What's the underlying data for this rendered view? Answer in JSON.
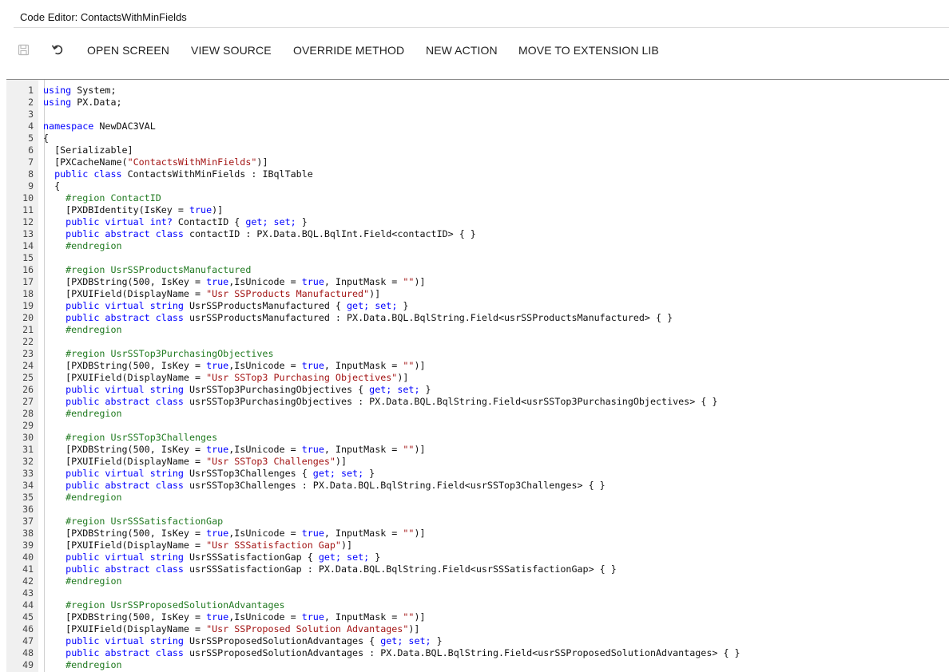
{
  "window": {
    "title": "Code Editor: ContactsWithMinFields"
  },
  "toolbar": {
    "save_icon": "save-icon",
    "undo_icon": "undo-icon",
    "buttons": [
      {
        "label": "OPEN SCREEN"
      },
      {
        "label": "VIEW SOURCE"
      },
      {
        "label": "OVERRIDE METHOD"
      },
      {
        "label": "NEW ACTION"
      },
      {
        "label": "MOVE TO EXTENSION LIB"
      }
    ]
  },
  "colors": {
    "keyword": "#0000ff",
    "string": "#a31515",
    "region": "#217a21",
    "gutter_bg": "#f0f0f0"
  },
  "code": {
    "lines": [
      [
        {
          "t": "using",
          "k": "kw"
        },
        {
          "t": " System;"
        }
      ],
      [
        {
          "t": "using",
          "k": "kw"
        },
        {
          "t": " PX.Data;"
        }
      ],
      [],
      [
        {
          "t": "namespace",
          "k": "kw"
        },
        {
          "t": " NewDAC3VAL"
        }
      ],
      [
        {
          "t": "{"
        }
      ],
      [
        {
          "t": "  [Serializable]"
        }
      ],
      [
        {
          "t": "  [PXCacheName("
        },
        {
          "t": "\"ContactsWithMinFields\"",
          "k": "str"
        },
        {
          "t": ")]"
        }
      ],
      [
        {
          "t": "  "
        },
        {
          "t": "public class",
          "k": "kw"
        },
        {
          "t": " ContactsWithMinFields : IBqlTable"
        }
      ],
      [
        {
          "t": "  {"
        }
      ],
      [
        {
          "t": "    #region ContactID",
          "k": "reg"
        }
      ],
      [
        {
          "t": "    [PXDBIdentity(IsKey = "
        },
        {
          "t": "true",
          "k": "kw"
        },
        {
          "t": ")]"
        }
      ],
      [
        {
          "t": "    "
        },
        {
          "t": "public virtual int?",
          "k": "kw"
        },
        {
          "t": " ContactID { "
        },
        {
          "t": "get;",
          "k": "kw"
        },
        {
          "t": " "
        },
        {
          "t": "set;",
          "k": "kw"
        },
        {
          "t": " }"
        }
      ],
      [
        {
          "t": "    "
        },
        {
          "t": "public abstract class",
          "k": "kw"
        },
        {
          "t": " contactID : PX.Data.BQL.BqlInt.Field<contactID> { }"
        }
      ],
      [
        {
          "t": "    #endregion",
          "k": "reg"
        }
      ],
      [],
      [
        {
          "t": "    #region UsrSSProductsManufactured",
          "k": "reg"
        }
      ],
      [
        {
          "t": "    [PXDBString(500, IsKey = "
        },
        {
          "t": "true",
          "k": "kw"
        },
        {
          "t": ",IsUnicode = "
        },
        {
          "t": "true",
          "k": "kw"
        },
        {
          "t": ", InputMask = "
        },
        {
          "t": "\"\"",
          "k": "str"
        },
        {
          "t": ")]"
        }
      ],
      [
        {
          "t": "    [PXUIField(DisplayName = "
        },
        {
          "t": "\"Usr SSProducts Manufactured\"",
          "k": "str"
        },
        {
          "t": ")]"
        }
      ],
      [
        {
          "t": "    "
        },
        {
          "t": "public virtual string",
          "k": "kw"
        },
        {
          "t": " UsrSSProductsManufactured { "
        },
        {
          "t": "get;",
          "k": "kw"
        },
        {
          "t": " "
        },
        {
          "t": "set;",
          "k": "kw"
        },
        {
          "t": " }"
        }
      ],
      [
        {
          "t": "    "
        },
        {
          "t": "public abstract class",
          "k": "kw"
        },
        {
          "t": " usrSSProductsManufactured : PX.Data.BQL.BqlString.Field<usrSSProductsManufactured> { }"
        }
      ],
      [
        {
          "t": "    #endregion",
          "k": "reg"
        }
      ],
      [],
      [
        {
          "t": "    #region UsrSSTop3PurchasingObjectives",
          "k": "reg"
        }
      ],
      [
        {
          "t": "    [PXDBString(500, IsKey = "
        },
        {
          "t": "true",
          "k": "kw"
        },
        {
          "t": ",IsUnicode = "
        },
        {
          "t": "true",
          "k": "kw"
        },
        {
          "t": ", InputMask = "
        },
        {
          "t": "\"\"",
          "k": "str"
        },
        {
          "t": ")]"
        }
      ],
      [
        {
          "t": "    [PXUIField(DisplayName = "
        },
        {
          "t": "\"Usr SSTop3 Purchasing Objectives\"",
          "k": "str"
        },
        {
          "t": ")]"
        }
      ],
      [
        {
          "t": "    "
        },
        {
          "t": "public virtual string",
          "k": "kw"
        },
        {
          "t": " UsrSSTop3PurchasingObjectives { "
        },
        {
          "t": "get;",
          "k": "kw"
        },
        {
          "t": " "
        },
        {
          "t": "set;",
          "k": "kw"
        },
        {
          "t": " }"
        }
      ],
      [
        {
          "t": "    "
        },
        {
          "t": "public abstract class",
          "k": "kw"
        },
        {
          "t": " usrSSTop3PurchasingObjectives : PX.Data.BQL.BqlString.Field<usrSSTop3PurchasingObjectives> { }"
        }
      ],
      [
        {
          "t": "    #endregion",
          "k": "reg"
        }
      ],
      [],
      [
        {
          "t": "    #region UsrSSTop3Challenges",
          "k": "reg"
        }
      ],
      [
        {
          "t": "    [PXDBString(500, IsKey = "
        },
        {
          "t": "true",
          "k": "kw"
        },
        {
          "t": ",IsUnicode = "
        },
        {
          "t": "true",
          "k": "kw"
        },
        {
          "t": ", InputMask = "
        },
        {
          "t": "\"\"",
          "k": "str"
        },
        {
          "t": ")]"
        }
      ],
      [
        {
          "t": "    [PXUIField(DisplayName = "
        },
        {
          "t": "\"Usr SSTop3 Challenges\"",
          "k": "str"
        },
        {
          "t": ")]"
        }
      ],
      [
        {
          "t": "    "
        },
        {
          "t": "public virtual string",
          "k": "kw"
        },
        {
          "t": " UsrSSTop3Challenges { "
        },
        {
          "t": "get;",
          "k": "kw"
        },
        {
          "t": " "
        },
        {
          "t": "set;",
          "k": "kw"
        },
        {
          "t": " }"
        }
      ],
      [
        {
          "t": "    "
        },
        {
          "t": "public abstract class",
          "k": "kw"
        },
        {
          "t": " usrSSTop3Challenges : PX.Data.BQL.BqlString.Field<usrSSTop3Challenges> { }"
        }
      ],
      [
        {
          "t": "    #endregion",
          "k": "reg"
        }
      ],
      [],
      [
        {
          "t": "    #region UsrSSSatisfactionGap",
          "k": "reg"
        }
      ],
      [
        {
          "t": "    [PXDBString(500, IsKey = "
        },
        {
          "t": "true",
          "k": "kw"
        },
        {
          "t": ",IsUnicode = "
        },
        {
          "t": "true",
          "k": "kw"
        },
        {
          "t": ", InputMask = "
        },
        {
          "t": "\"\"",
          "k": "str"
        },
        {
          "t": ")]"
        }
      ],
      [
        {
          "t": "    [PXUIField(DisplayName = "
        },
        {
          "t": "\"Usr SSSatisfaction Gap\"",
          "k": "str"
        },
        {
          "t": ")]"
        }
      ],
      [
        {
          "t": "    "
        },
        {
          "t": "public virtual string",
          "k": "kw"
        },
        {
          "t": " UsrSSSatisfactionGap { "
        },
        {
          "t": "get;",
          "k": "kw"
        },
        {
          "t": " "
        },
        {
          "t": "set;",
          "k": "kw"
        },
        {
          "t": " }"
        }
      ],
      [
        {
          "t": "    "
        },
        {
          "t": "public abstract class",
          "k": "kw"
        },
        {
          "t": " usrSSSatisfactionGap : PX.Data.BQL.BqlString.Field<usrSSSatisfactionGap> { }"
        }
      ],
      [
        {
          "t": "    #endregion",
          "k": "reg"
        }
      ],
      [],
      [
        {
          "t": "    #region UsrSSProposedSolutionAdvantages",
          "k": "reg"
        }
      ],
      [
        {
          "t": "    [PXDBString(500, IsKey = "
        },
        {
          "t": "true",
          "k": "kw"
        },
        {
          "t": ",IsUnicode = "
        },
        {
          "t": "true",
          "k": "kw"
        },
        {
          "t": ", InputMask = "
        },
        {
          "t": "\"\"",
          "k": "str"
        },
        {
          "t": ")]"
        }
      ],
      [
        {
          "t": "    [PXUIField(DisplayName = "
        },
        {
          "t": "\"Usr SSProposed Solution Advantages\"",
          "k": "str"
        },
        {
          "t": ")]"
        }
      ],
      [
        {
          "t": "    "
        },
        {
          "t": "public virtual string",
          "k": "kw"
        },
        {
          "t": " UsrSSProposedSolutionAdvantages { "
        },
        {
          "t": "get;",
          "k": "kw"
        },
        {
          "t": " "
        },
        {
          "t": "set;",
          "k": "kw"
        },
        {
          "t": " }"
        }
      ],
      [
        {
          "t": "    "
        },
        {
          "t": "public abstract class",
          "k": "kw"
        },
        {
          "t": " usrSSProposedSolutionAdvantages : PX.Data.BQL.BqlString.Field<usrSSProposedSolutionAdvantages> { }"
        }
      ],
      [
        {
          "t": "    #endregion",
          "k": "reg"
        }
      ]
    ]
  }
}
